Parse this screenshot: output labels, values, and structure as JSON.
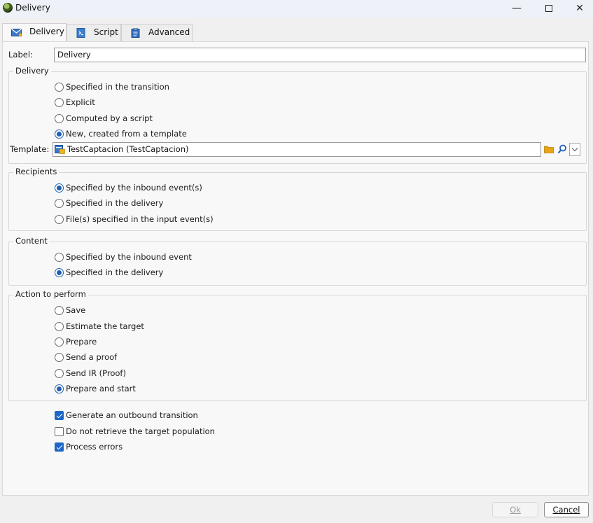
{
  "window": {
    "title": "Delivery",
    "minimize": "—",
    "close": "✕"
  },
  "tabs": [
    {
      "label": "Delivery",
      "icon": "envelope-star-icon",
      "active": true
    },
    {
      "label": "Script",
      "icon": "script-icon",
      "active": false
    },
    {
      "label": "Advanced",
      "icon": "clipboard-icon",
      "active": false
    }
  ],
  "label_field": {
    "label": "Label:",
    "value": "Delivery"
  },
  "delivery_group": {
    "legend": "Delivery",
    "options": [
      {
        "label": "Specified in the transition",
        "selected": false
      },
      {
        "label": "Explicit",
        "selected": false
      },
      {
        "label": "Computed by a script",
        "selected": false
      },
      {
        "label": "New, created from a template",
        "selected": true
      }
    ],
    "template": {
      "label": "Template:",
      "value": "TestCaptacion (TestCaptacion)"
    }
  },
  "recipients_group": {
    "legend": "Recipients",
    "options": [
      {
        "label": "Specified by the inbound event(s)",
        "selected": true
      },
      {
        "label": "Specified in the delivery",
        "selected": false
      },
      {
        "label": "File(s) specified in the input event(s)",
        "selected": false
      }
    ]
  },
  "content_group": {
    "legend": "Content",
    "options": [
      {
        "label": "Specified by the inbound event",
        "selected": false
      },
      {
        "label": "Specified in the delivery",
        "selected": true
      }
    ]
  },
  "action_group": {
    "legend": "Action to perform",
    "options": [
      {
        "label": "Save",
        "selected": false
      },
      {
        "label": "Estimate the target",
        "selected": false
      },
      {
        "label": "Prepare",
        "selected": false
      },
      {
        "label": "Send a proof",
        "selected": false
      },
      {
        "label": "Send IR (Proof)",
        "selected": false
      },
      {
        "label": "Prepare and start",
        "selected": true
      }
    ]
  },
  "checkboxes": [
    {
      "label": "Generate an outbound transition",
      "checked": true
    },
    {
      "label": "Do not retrieve the target population",
      "checked": false
    },
    {
      "label": "Process errors",
      "checked": true
    }
  ],
  "buttons": {
    "ok": "Ok",
    "cancel": "Cancel",
    "ok_enabled": false
  },
  "colors": {
    "accent": "#1e5fb3",
    "folder": "#e8a615"
  }
}
